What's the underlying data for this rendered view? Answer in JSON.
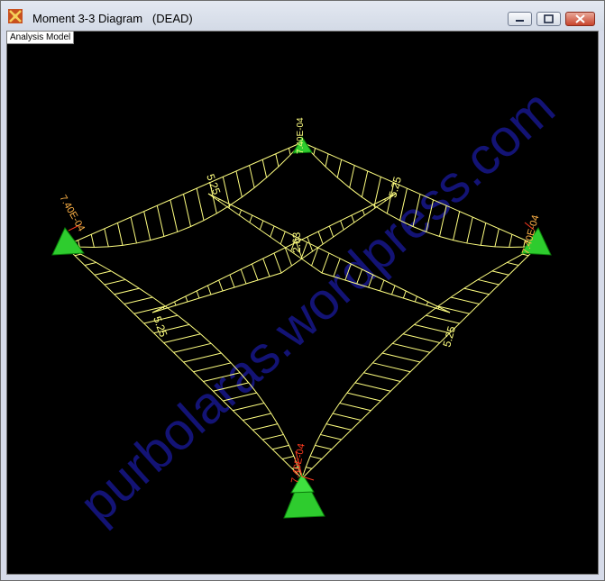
{
  "window": {
    "title": "Moment 3-3 Diagram   (DEAD)",
    "minimize_icon": "minimize-icon",
    "maximize_icon": "maximize-icon",
    "close_icon": "close-icon",
    "app_icon": "sap2000-app-icon"
  },
  "view": {
    "label": "Analysis Model",
    "background": "#000000"
  },
  "colors": {
    "diagram": "#ffff80",
    "support": "#2ecc2e",
    "support_dark": "#0a7a0a",
    "reaction_label": "#ff3b1f",
    "watermark": "#1a1a8c"
  },
  "diagram_labels": {
    "center": "2.63",
    "top_left_beam": "5.25",
    "top_right_beam": "5.25",
    "left_beam": "5.25",
    "right_beam": "5.25",
    "support_top": "7.40E-04",
    "support_left": "7.40E-04",
    "support_right": "7.40E-04",
    "support_bottom": "7.40E-04"
  },
  "watermark": {
    "text": "purbolaras.wordpress.com"
  }
}
